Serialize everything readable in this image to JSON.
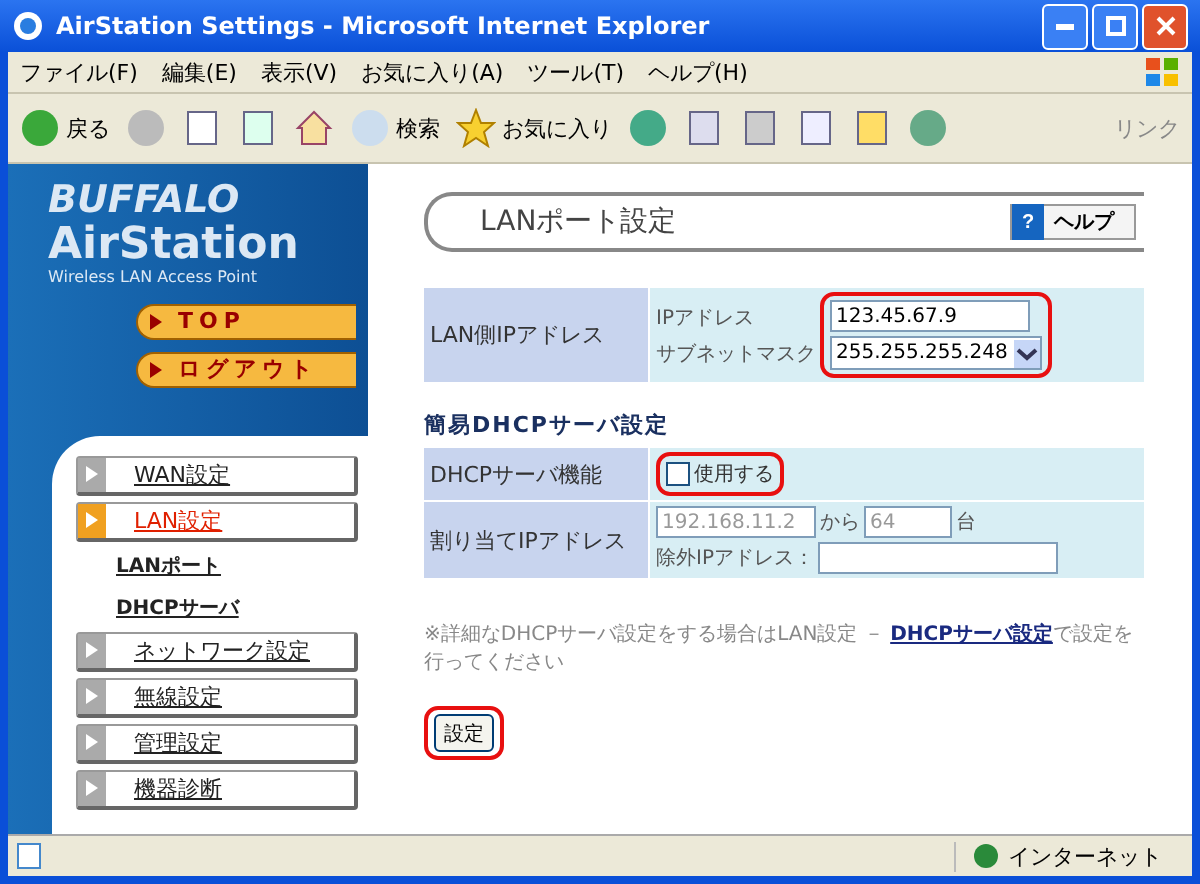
{
  "window": {
    "title": "AirStation Settings - Microsoft Internet Explorer"
  },
  "menu": [
    "ファイル(F)",
    "編集(E)",
    "表示(V)",
    "お気に入り(A)",
    "ツール(T)",
    "ヘルプ(H)"
  ],
  "toolbar": {
    "back": "戻る",
    "search": "検索",
    "favorites": "お気に入り",
    "links": "リンク"
  },
  "sidebar": {
    "brand": "BUFFALO",
    "product": "AirStation",
    "tagline": "Wireless LAN Access Point",
    "top_buttons": [
      "TOP",
      "ログアウト"
    ],
    "items": [
      {
        "label": "WAN設定",
        "selected": false
      },
      {
        "label": "LAN設定",
        "selected": true,
        "children": [
          {
            "label": "LANポート"
          },
          {
            "label": "DHCPサーバ"
          }
        ]
      },
      {
        "label": "ネットワーク設定",
        "selected": false
      },
      {
        "label": "無線設定",
        "selected": false
      },
      {
        "label": "管理設定",
        "selected": false
      },
      {
        "label": "機器診断",
        "selected": false
      }
    ]
  },
  "page": {
    "title": "LANポート設定",
    "help_icon": "?",
    "help": "ヘルプ",
    "lan": {
      "label": "LAN側IPアドレス",
      "ip_label": "IPアドレス",
      "ip_value": "123.45.67.9",
      "mask_label": "サブネットマスク",
      "mask_value": "255.255.255.248"
    },
    "dhcp_heading": "簡易DHCPサーバ設定",
    "dhcp": {
      "label": "DHCPサーバ機能",
      "enable_label": "使用する",
      "checked": false,
      "assign_label": "割り当てIPアドレス",
      "start_value": "192.168.11.2",
      "from": "から",
      "count_value": "64",
      "unit": "台",
      "disabled": true,
      "exclude_label": "除外IPアドレス："
    },
    "note": {
      "before": "※詳細なDHCPサーバ設定をする場合はLAN設定 － ",
      "link": "DHCPサーバ設定",
      "after": "で設定を行ってください"
    },
    "submit": "設定"
  },
  "status_bar": {
    "zone": "インターネット"
  }
}
